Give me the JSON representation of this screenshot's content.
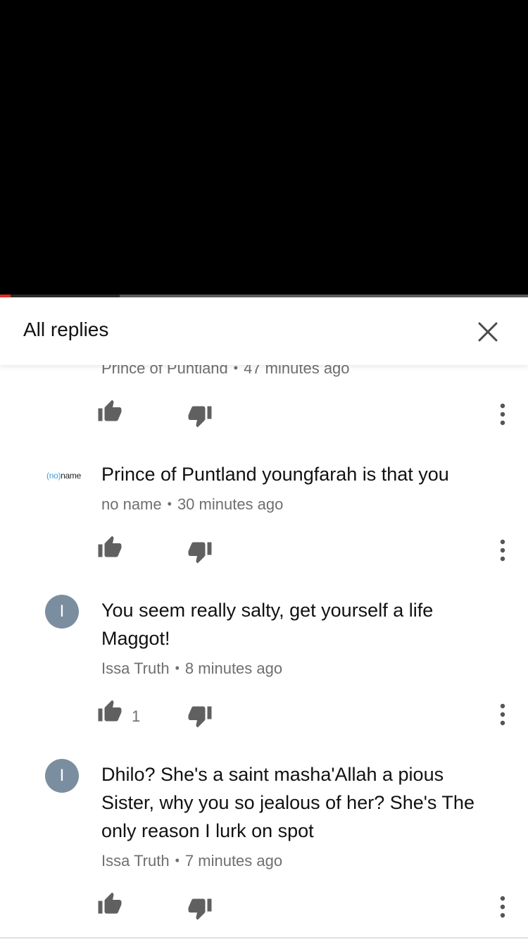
{
  "player": {
    "progress_fraction": 0.02,
    "buffered_fraction": 0.227
  },
  "panel": {
    "title": "All replies"
  },
  "comments": [
    {
      "author": "Prince of Puntland",
      "time": "47 minutes ago",
      "text": "",
      "likes": ""
    },
    {
      "author": "no name",
      "time": "30 minutes ago",
      "text": "Prince of Puntland youngfarah is that you",
      "likes": "",
      "avatar_text": "(no)name"
    },
    {
      "author": "Issa Truth",
      "time": "8 minutes ago",
      "text": "You seem really salty, get yourself a life Maggot!",
      "likes": "1",
      "avatar_letter": "I"
    },
    {
      "author": "Issa Truth",
      "time": "7 minutes ago",
      "text": "Dhilo? She's a saint masha'Allah a pious Sister, why you so jealous of her? She's The only reason I lurk on spot",
      "likes": "",
      "avatar_letter": "I"
    }
  ],
  "colors": {
    "accent_red": "#e32b25",
    "avatar_gray_blue": "#7b8ea0",
    "meta_gray": "#6f6f6f"
  },
  "icons": [
    "close-icon",
    "thumb-up-icon",
    "thumb-down-icon",
    "more-vert-icon"
  ]
}
